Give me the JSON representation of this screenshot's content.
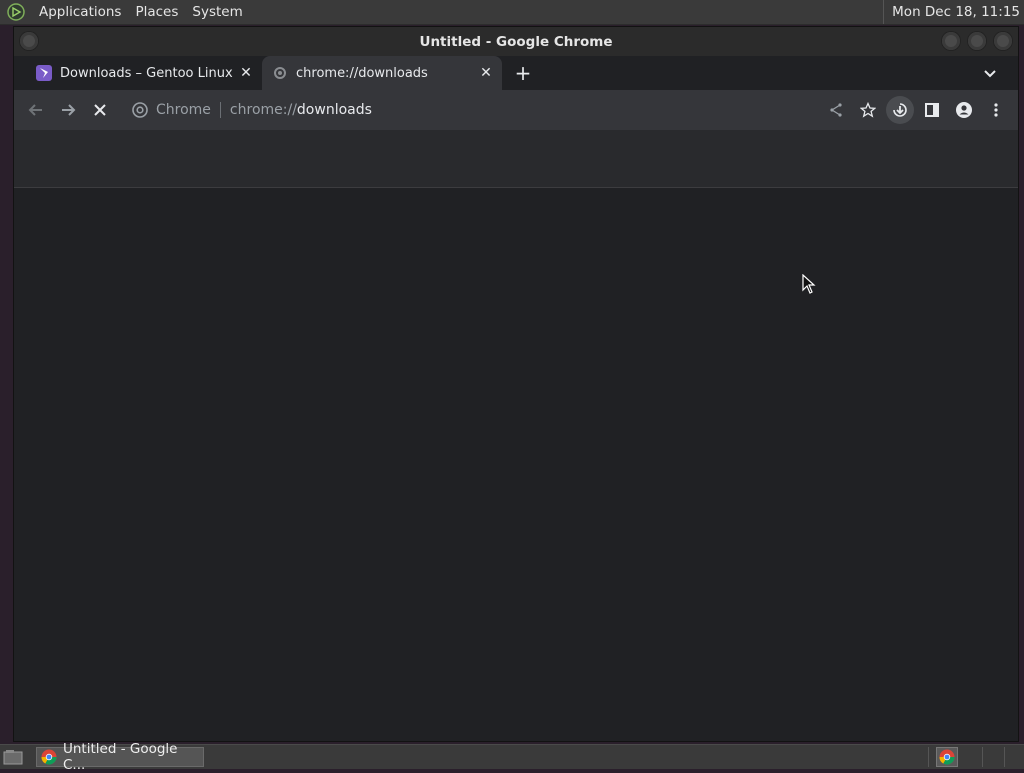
{
  "top_panel": {
    "menus": [
      "Applications",
      "Places",
      "System"
    ],
    "clock": "Mon Dec 18, 11:15"
  },
  "window": {
    "title": "Untitled - Google Chrome"
  },
  "tabs": [
    {
      "title": "Downloads – Gentoo Linux",
      "icon": "gentoo-icon",
      "active": false
    },
    {
      "title": "chrome://downloads",
      "icon": "loading-icon",
      "active": true
    }
  ],
  "toolbar": {
    "chip_label": "Chrome",
    "url_scheme": "chrome://",
    "url_host": "downloads"
  },
  "taskbar": {
    "task_label": "Untitled - Google C..."
  },
  "colors": {
    "page_bg": "#202124",
    "toolbar_bg": "#35363a",
    "panel_bg": "#3a3a3a"
  }
}
